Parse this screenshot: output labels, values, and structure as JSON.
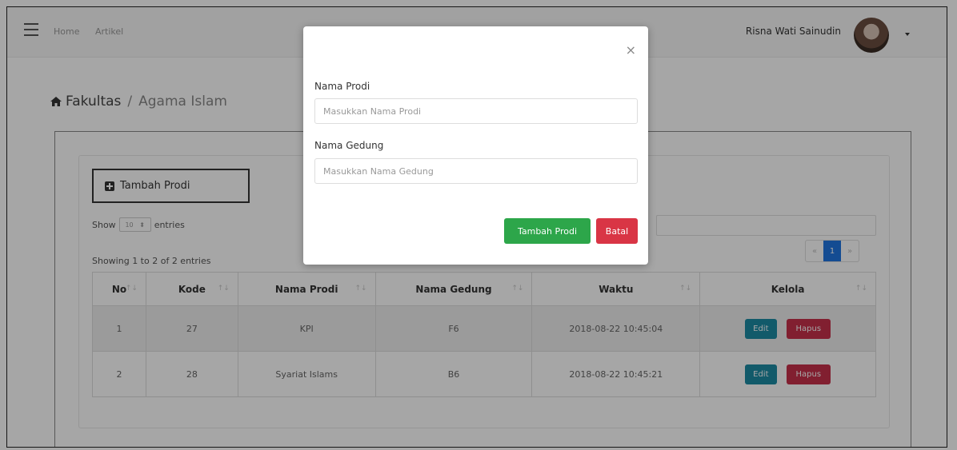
{
  "nav": {
    "home": "Home",
    "artikel": "Artikel",
    "user_name": "Risna Wati Sainudin"
  },
  "breadcrumb": {
    "parent": "Fakultas",
    "separator": "/",
    "current": "Agama Islam"
  },
  "toolbar": {
    "add_label": "Tambah Prodi"
  },
  "table_controls": {
    "show_label": "Show",
    "entries_value": "10",
    "entries_label": "entries",
    "info": "Showing 1 to 2 of 2 entries"
  },
  "pagination": {
    "prev": "«",
    "current": "1",
    "next": "»"
  },
  "table": {
    "headers": [
      "No",
      "Kode",
      "Nama Prodi",
      "Nama Gedung",
      "Waktu",
      "Kelola"
    ],
    "sort_glyph": "↑↓",
    "rows": [
      {
        "no": "1",
        "kode": "27",
        "nama_prodi": "KPI",
        "nama_gedung": "F6",
        "waktu": "2018-08-22 10:45:04"
      },
      {
        "no": "2",
        "kode": "28",
        "nama_prodi": "Syariat Islams",
        "nama_gedung": "B6",
        "waktu": "2018-08-22 10:45:21"
      }
    ],
    "edit_label": "Edit",
    "delete_label": "Hapus"
  },
  "modal": {
    "close": "×",
    "prodi_label": "Nama Prodi",
    "prodi_placeholder": "Masukkan Nama Prodi",
    "gedung_label": "Nama Gedung",
    "gedung_placeholder": "Masukkan Nama Gedung",
    "submit_label": "Tambah Prodi",
    "cancel_label": "Batal"
  }
}
